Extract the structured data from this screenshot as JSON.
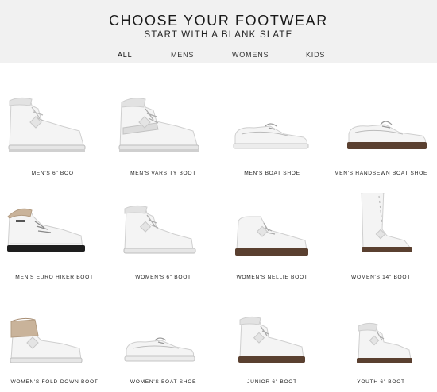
{
  "header": {
    "title": "CHOOSE YOUR FOOTWEAR",
    "subtitle": "START WITH A BLANK SLATE"
  },
  "tabs": [
    {
      "label": "ALL",
      "active": true
    },
    {
      "label": "MENS",
      "active": false
    },
    {
      "label": "WOMENS",
      "active": false
    },
    {
      "label": "KIDS",
      "active": false
    }
  ],
  "products": [
    {
      "label": "MEN'S 6\" BOOT",
      "kind": "boot"
    },
    {
      "label": "MEN'S VARSITY BOOT",
      "kind": "varsity"
    },
    {
      "label": "MEN'S BOAT SHOE",
      "kind": "boat"
    },
    {
      "label": "MEN'S HANDSEWN BOAT SHOE",
      "kind": "handsewn"
    },
    {
      "label": "MEN'S EURO HIKER BOOT",
      "kind": "hiker"
    },
    {
      "label": "WOMEN'S 6\" BOOT",
      "kind": "boot-slim"
    },
    {
      "label": "WOMEN'S NELLIE BOOT",
      "kind": "nellie"
    },
    {
      "label": "WOMEN'S 14\" BOOT",
      "kind": "tall"
    },
    {
      "label": "WOMEN'S FOLD-DOWN BOOT",
      "kind": "folddown"
    },
    {
      "label": "WOMEN'S BOAT SHOE",
      "kind": "boat-w"
    },
    {
      "label": "JUNIOR 6\" BOOT",
      "kind": "junior"
    },
    {
      "label": "YOUTH 6\" BOOT",
      "kind": "youth"
    }
  ],
  "colors": {
    "header_bg": "#f1f1f1",
    "leather": "#f4f4f4",
    "leather_shade": "#d9d9d9",
    "sole_white": "#e6e6e6",
    "sole_brown": "#5a4030",
    "sole_black": "#1e1e1e",
    "tan": "#c9b39a"
  }
}
